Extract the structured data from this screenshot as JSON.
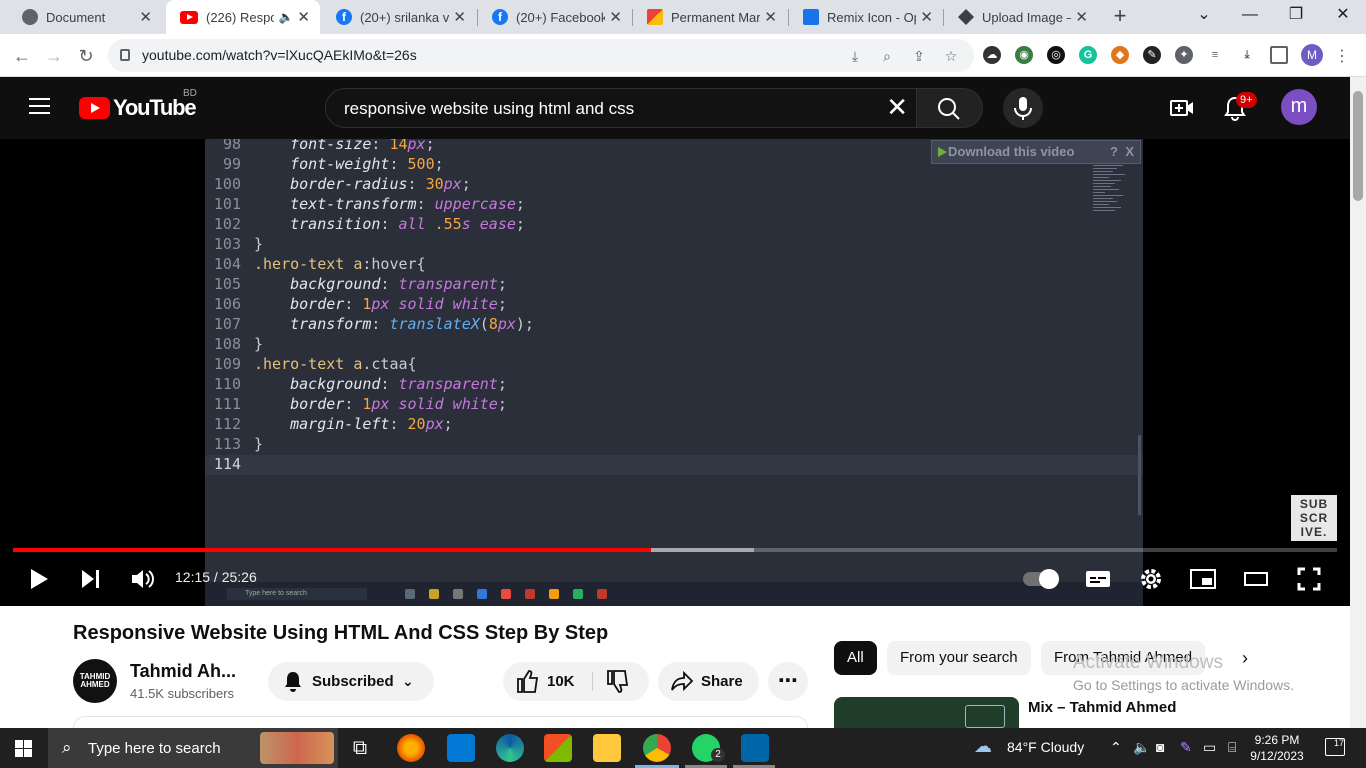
{
  "browser": {
    "tabs": [
      {
        "title": "Document",
        "icon": "globe-icon"
      },
      {
        "title": "(226) Respon",
        "icon": "youtube-icon",
        "active": true
      },
      {
        "title": "(20+) srilanka vs",
        "icon": "facebook-icon"
      },
      {
        "title": "(20+) Facebook L",
        "icon": "facebook-icon"
      },
      {
        "title": "Permanent Mark",
        "icon": "permanent-marker-icon"
      },
      {
        "title": "Remix Icon - Ope",
        "icon": "remix-icon"
      },
      {
        "title": "Upload Image – ",
        "icon": "upload-icon"
      }
    ],
    "url": "youtube.com/watch?v=lXucQAEkIMo&t=26s",
    "profile_letter": "M"
  },
  "youtube": {
    "logo_text": "YouTube",
    "country_code": "BD",
    "search_query": "responsive website using html and css",
    "notifications_badge": "9+",
    "avatar_letter": "m"
  },
  "player": {
    "download_banner": "Download this video",
    "download_banner_help": "?",
    "download_banner_close": "X",
    "watermark": "SUB SCR IVE.",
    "time_current": "12:15",
    "time_separator": " / ",
    "time_total": "25:26",
    "progress_fraction": 0.4816,
    "buffered_fraction": 0.5597,
    "code_lines": [
      {
        "n": "98",
        "parts": [
          [
            "    ",
            "p"
          ],
          [
            "font-size",
            "prop"
          ],
          [
            ": ",
            "p"
          ],
          [
            "14",
            "num"
          ],
          [
            "px",
            "val"
          ],
          [
            ";",
            "p"
          ]
        ]
      },
      {
        "n": "99",
        "parts": [
          [
            "    ",
            "p"
          ],
          [
            "font-weight",
            "prop"
          ],
          [
            ": ",
            "p"
          ],
          [
            "500",
            "num"
          ],
          [
            ";",
            "p"
          ]
        ]
      },
      {
        "n": "100",
        "parts": [
          [
            "    ",
            "p"
          ],
          [
            "border-radius",
            "prop"
          ],
          [
            ": ",
            "p"
          ],
          [
            "30",
            "num"
          ],
          [
            "px",
            "val"
          ],
          [
            ";",
            "p"
          ]
        ]
      },
      {
        "n": "101",
        "parts": [
          [
            "    ",
            "p"
          ],
          [
            "text-transform",
            "prop"
          ],
          [
            ": ",
            "p"
          ],
          [
            "uppercase",
            "val"
          ],
          [
            ";",
            "p"
          ]
        ]
      },
      {
        "n": "102",
        "parts": [
          [
            "    ",
            "p"
          ],
          [
            "transition",
            "prop"
          ],
          [
            ": ",
            "p"
          ],
          [
            "all ",
            "val"
          ],
          [
            ".55",
            "num"
          ],
          [
            "s ease",
            "val"
          ],
          [
            ";",
            "p"
          ]
        ]
      },
      {
        "n": "103",
        "parts": [
          [
            "}",
            "p"
          ]
        ]
      },
      {
        "n": "104",
        "parts": [
          [
            ".hero-text ",
            "sel"
          ],
          [
            "a",
            "sel"
          ],
          [
            ":hover{",
            "p"
          ]
        ]
      },
      {
        "n": "105",
        "parts": [
          [
            "    ",
            "p"
          ],
          [
            "background",
            "prop"
          ],
          [
            ": ",
            "p"
          ],
          [
            "transparent",
            "val"
          ],
          [
            ";",
            "p"
          ]
        ]
      },
      {
        "n": "106",
        "parts": [
          [
            "    ",
            "p"
          ],
          [
            "border",
            "prop"
          ],
          [
            ": ",
            "p"
          ],
          [
            "1",
            "num"
          ],
          [
            "px solid white",
            "val"
          ],
          [
            ";",
            "p"
          ]
        ]
      },
      {
        "n": "107",
        "parts": [
          [
            "    ",
            "p"
          ],
          [
            "transform",
            "prop"
          ],
          [
            ": ",
            "p"
          ],
          [
            "translateX",
            "fn"
          ],
          [
            "(",
            "p"
          ],
          [
            "8",
            "num"
          ],
          [
            "px",
            "val"
          ],
          [
            ");",
            "p"
          ]
        ]
      },
      {
        "n": "108",
        "parts": [
          [
            "}",
            "p"
          ]
        ]
      },
      {
        "n": "109",
        "parts": [
          [
            ".hero-text ",
            "sel"
          ],
          [
            "a",
            "sel"
          ],
          [
            ".ctaa{",
            "p"
          ]
        ]
      },
      {
        "n": "110",
        "parts": [
          [
            "    ",
            "p"
          ],
          [
            "background",
            "prop"
          ],
          [
            ": ",
            "p"
          ],
          [
            "transparent",
            "val"
          ],
          [
            ";",
            "p"
          ]
        ]
      },
      {
        "n": "111",
        "parts": [
          [
            "    ",
            "p"
          ],
          [
            "border",
            "prop"
          ],
          [
            ": ",
            "p"
          ],
          [
            "1",
            "num"
          ],
          [
            "px solid white",
            "val"
          ],
          [
            ";",
            "p"
          ]
        ]
      },
      {
        "n": "112",
        "parts": [
          [
            "    ",
            "p"
          ],
          [
            "margin-left",
            "prop"
          ],
          [
            ": ",
            "p"
          ],
          [
            "20",
            "num"
          ],
          [
            "px",
            "val"
          ],
          [
            ";",
            "p"
          ]
        ]
      },
      {
        "n": "113",
        "parts": [
          [
            "}",
            "p"
          ]
        ]
      },
      {
        "n": "114",
        "parts": []
      }
    ],
    "inner_taskbar_search": "Type here to search"
  },
  "video": {
    "title": "Responsive Website Using HTML And CSS Step By Step",
    "channel_avatar_text": "TAHMID AHMED",
    "channel_name": "Tahmid Ah...",
    "subscribers": "41.5K subscribers",
    "subscribed_label": "Subscribed",
    "likes": "10K",
    "share_label": "Share"
  },
  "sidebar": {
    "chips": [
      "All",
      "From your search",
      "From Tahmid Ahmed"
    ],
    "rec_title": "Mix – Tahmid Ahmed"
  },
  "windows": {
    "activate_title": "Activate Windows",
    "activate_sub": "Go to Settings to activate Windows.",
    "search_placeholder": "Type here to search",
    "weather": "84°F  Cloudy",
    "time": "9:26 PM",
    "date": "9/12/2023",
    "notification_count": "17",
    "whatsapp_badge": "2"
  }
}
